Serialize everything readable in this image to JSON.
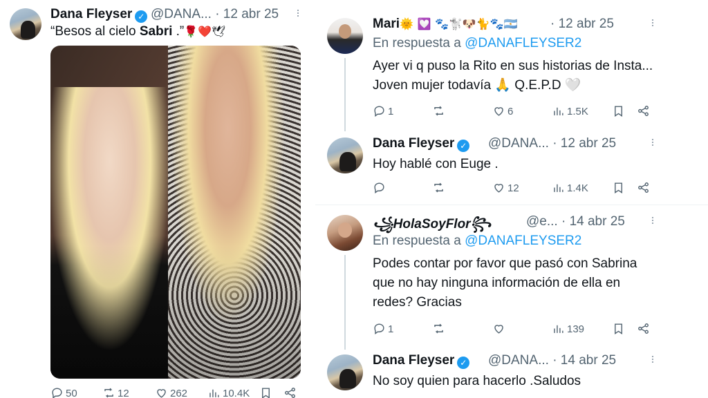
{
  "left_tweet": {
    "name": "Dana Fleyser",
    "handle_date": "@DANA...  · 12 abr 25",
    "text_prefix": "“Besos al cielo ",
    "text_bold": "Sabri",
    "text_suffix": " .”",
    "text_emoji": "🌹❤️🕊",
    "photo_alt": "Two women posing together",
    "stats": {
      "replies": "50",
      "reposts": "12",
      "likes": "262",
      "views": "10.4K"
    }
  },
  "thread": [
    {
      "name": "Mari",
      "name_emoji": "🌞 💟 🐾🐩🐶🐈🐾🇦🇷",
      "handle_date": "· 12 abr 25",
      "reply_prefix": "En respuesta a ",
      "reply_mention": "@DANAFLEYSER2",
      "text": "Ayer vi q puso la Rito en sus historias de Insta... Joven mujer todavía 🙏 Q.E.P.D 🤍",
      "stats": {
        "replies": "1",
        "reposts": "",
        "likes": "6",
        "views": "1.5K"
      }
    },
    {
      "name": "Dana Fleyser",
      "handle_date": "@DANA...  · 12 abr 25",
      "text": "Hoy hablé con Euge .",
      "stats": {
        "replies": "",
        "reposts": "",
        "likes": "12",
        "views": "1.4K"
      }
    },
    {
      "name": "꧁HolaSoyFlor꧂",
      "handle_date": "@e...  · 14 abr 25",
      "reply_prefix": "En respuesta a ",
      "reply_mention": "@DANAFLEYSER2",
      "text": "Podes contar por favor que pasó con Sabrina que no hay ninguna información de ella en redes? Gracias",
      "stats": {
        "replies": "1",
        "reposts": "",
        "likes": "",
        "views": "139"
      }
    },
    {
      "name": "Dana Fleyser",
      "handle_date": "@DANA...  · 14 abr 25",
      "text": "No soy quien para hacerlo .Saludos"
    }
  ],
  "icons": {
    "reply": "reply-icon",
    "repost": "repost-icon",
    "like": "heart-icon",
    "views": "views-icon",
    "bookmark": "bookmark-icon",
    "share": "share-icon",
    "verified": "verified-badge-icon",
    "more": "more-icon"
  },
  "colors": {
    "link": "#1d9bf0",
    "muted": "#536471",
    "text": "#0f1419",
    "verified": "#1d9bf0"
  }
}
